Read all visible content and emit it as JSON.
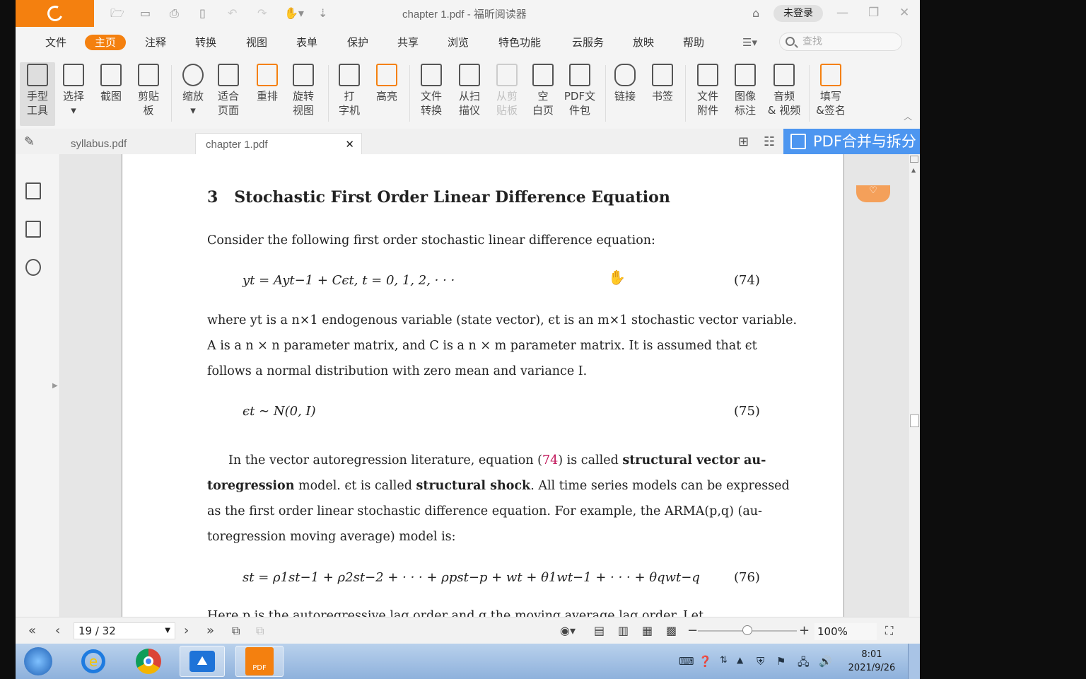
{
  "app": {
    "title": "chapter 1.pdf - 福昕阅读器",
    "login": "未登录",
    "window_controls": {
      "minimize": "—",
      "restore": "❐",
      "close": "✕"
    }
  },
  "menu": [
    "文件",
    "主页",
    "注释",
    "转换",
    "视图",
    "表单",
    "保护",
    "共享",
    "浏览",
    "特色功能",
    "云服务",
    "放映",
    "帮助"
  ],
  "search_placeholder": "查找",
  "ribbon": [
    {
      "line1": "手型",
      "line2": "工具",
      "icon": "hand-icon"
    },
    {
      "line1": "选择",
      "line2": "",
      "icon": "select-text-icon"
    },
    {
      "line1": "截图",
      "line2": "",
      "icon": "snapshot-icon"
    },
    {
      "line1": "剪贴",
      "line2": "板",
      "icon": "clipboard-icon"
    },
    {
      "line1": "缩放",
      "line2": "",
      "icon": "zoom-icon"
    },
    {
      "line1": "适合",
      "line2": "页面",
      "icon": "fit-page-icon"
    },
    {
      "line1": "重排",
      "line2": "",
      "icon": "reflow-icon"
    },
    {
      "line1": "旋转",
      "line2": "视图",
      "icon": "rotate-view-icon"
    },
    {
      "line1": "打",
      "line2": "字机",
      "icon": "typewriter-icon"
    },
    {
      "line1": "高亮",
      "line2": "",
      "icon": "highlight-icon"
    },
    {
      "line1": "文件",
      "line2": "转换",
      "icon": "file-convert-icon"
    },
    {
      "line1": "从扫",
      "line2": "描仪",
      "icon": "scanner-icon"
    },
    {
      "line1": "从剪",
      "line2": "贴板",
      "icon": "from-clipboard-icon"
    },
    {
      "line1": "空",
      "line2": "白页",
      "icon": "blank-page-icon"
    },
    {
      "line1": "PDF文",
      "line2": "件包",
      "icon": "pdf-package-icon"
    },
    {
      "line1": "链接",
      "line2": "",
      "icon": "link-icon"
    },
    {
      "line1": "书签",
      "line2": "",
      "icon": "bookmark-icon"
    },
    {
      "line1": "文件",
      "line2": "附件",
      "icon": "attachment-icon"
    },
    {
      "line1": "图像",
      "line2": "标注",
      "icon": "image-annotation-icon"
    },
    {
      "line1": "音频",
      "line2": "& 视频",
      "icon": "audio-video-icon"
    },
    {
      "line1": "填写",
      "line2": "&签名",
      "icon": "fill-sign-icon"
    }
  ],
  "tabs": [
    {
      "label": "syllabus.pdf",
      "active": false
    },
    {
      "label": "chapter 1.pdf",
      "active": true
    }
  ],
  "merge_button": "PDF合并与拆分",
  "document": {
    "section_number": "3",
    "section_title": "Stochastic First Order Linear Difference Equation",
    "intro": "Consider the following first order stochastic linear difference equation:",
    "eq74": "yt = Ayt−1 + Cϵt,    t = 0, 1, 2, · · ·",
    "eq74_no": "(74)",
    "para1_l1": "where yt is a n×1 endogenous variable (state vector), ϵt is an m×1 stochastic vector variable.",
    "para1_l2": "A is a n × n parameter matrix, and C is a n × m parameter matrix. It is assumed that ϵt",
    "para1_l3": "follows a normal distribution with zero mean and variance I.",
    "eq75": "ϵt ∼ N(0, I)",
    "eq75_no": "(75)",
    "para2_l1_a": "In the vector autoregression literature, equation (",
    "para2_ref": "74",
    "para2_l1_b": ") is called ",
    "para2_l1_bold": "structural vector au-",
    "para2_l2_bold1": "toregression",
    "para2_l2_a": " model. ϵt is called ",
    "para2_l2_bold2": "structural shock",
    "para2_l2_b": ". All time series models can be expressed",
    "para2_l3": "as the first order linear stochastic difference equation. For example, the ARMA(p,q) (au-",
    "para2_l4": "toregression moving average) model is:",
    "eq76": "st = ρ1st−1 + ρ2st−2 + · · · + ρpst−p + wt + θ1wt−1 + · · · + θqwt−q",
    "eq76_no": "(76)",
    "cut_line": "Here p is the autoregressive lag order and q the moving average lag order. Let"
  },
  "status": {
    "page_indicator": "19 / 32",
    "zoom": "100%"
  },
  "taskbar": {
    "time": "8:01",
    "date": "2021/9/26"
  },
  "colors": {
    "accent": "#f4800f",
    "merge_blue": "#4d96f0",
    "ref_pink": "#c2185b"
  }
}
